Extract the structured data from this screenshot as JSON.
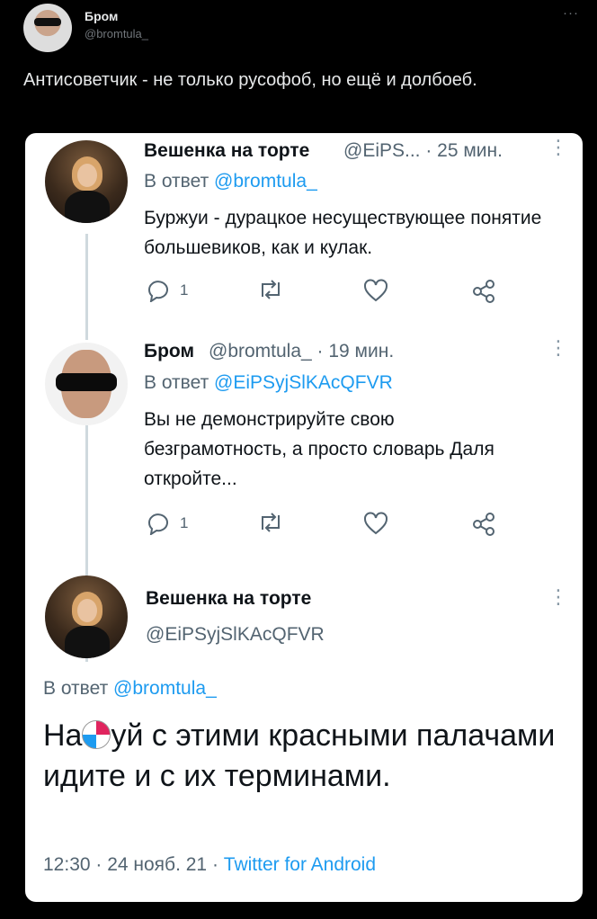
{
  "post": {
    "author_name": "Бром",
    "author_handle": "@bromtula_",
    "more": "···",
    "text": "Антисоветчик - не только русофоб, но ещё и долбоеб."
  },
  "card": {
    "tweets": [
      {
        "name": "Вешенка на торте",
        "handle_time": "@EiPS... · 25 мин.",
        "reply_label": "В ответ",
        "reply_to": "@bromtula_",
        "text": "Буржуи - дурацкое несуществующее понятие большевиков, как и кулак.",
        "reply_count": "1"
      },
      {
        "name": "Бром",
        "handle_time": "@bromtula_ · 19 мин.",
        "reply_label": "В ответ",
        "reply_to": "@EiPSyjSlKAcQFVR",
        "text": "Вы не демонстрируйте свою безграмотность, а просто словарь Даля откройте...",
        "reply_count": "1"
      }
    ],
    "main": {
      "name": "Вешенка на торте",
      "handle": "@EiPSyjSlKAcQFVR",
      "reply_label": "В ответ",
      "reply_to": "@bromtula_",
      "text_before": "На",
      "text_after": "уй с этими красными палачами  идите  и с их терминами.",
      "timestamp": "12:30 · 24 нояб. 21 · ",
      "source": "Twitter for Android"
    }
  },
  "colors": {
    "link": "#1d9bf0",
    "muted": "#536471",
    "bg": "#000000"
  },
  "icons": [
    "reply-icon",
    "retweet-icon",
    "like-icon",
    "share-icon",
    "kebab-icon"
  ]
}
